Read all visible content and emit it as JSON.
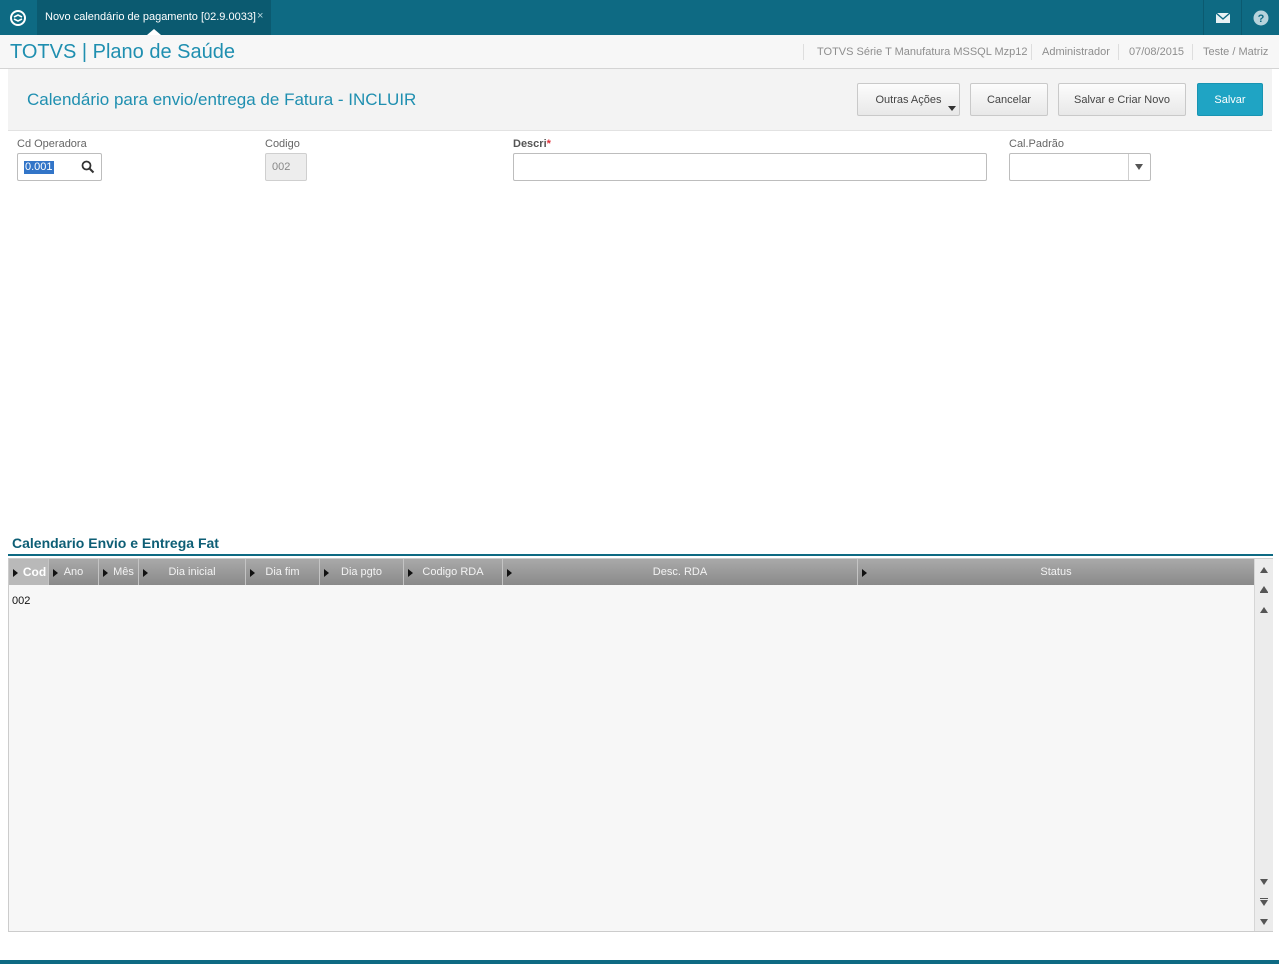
{
  "topbar": {
    "tab_label": "Novo calendário de pagamento [02.9.0033]",
    "tab_close": "×",
    "icons": [
      "totvs-logo-icon",
      "mail-icon",
      "help-icon"
    ]
  },
  "header": {
    "app_title": "TOTVS | Plano de Saúde",
    "system": "TOTVS Série T Manufatura MSSQL Mzp12",
    "user": "Administrador",
    "date": "07/08/2015",
    "branch": "Teste / Matriz"
  },
  "page": {
    "title": "Calendário para envio/entrega de Fatura - INCLUIR",
    "buttons": {
      "more_actions": "Outras Ações",
      "cancel": "Cancelar",
      "save_new": "Salvar e Criar Novo",
      "save": "Salvar"
    }
  },
  "form": {
    "cd_operadora_label": "Cd Operadora",
    "cd_operadora_value": "0.001",
    "codigo_label": "Codigo",
    "codigo_value": "002",
    "descri_label": "Descri",
    "descri_required": "*",
    "descri_value": "",
    "cal_padrao_label": "Cal.Padrão",
    "cal_padrao_value": ""
  },
  "grid": {
    "title": "Calendario Envio e Entrega Fat",
    "columns": [
      "Cod",
      "Ano",
      "Mês",
      "Dia inicial",
      "Dia fim",
      "Dia pgto",
      "Codigo RDA",
      "Desc. RDA",
      "Status"
    ],
    "rows": [
      [
        "002",
        "",
        "",
        "",
        "",
        "",
        "",
        "",
        ""
      ]
    ]
  },
  "colors": {
    "topbar": "#0e6a83",
    "accent": "#1f8fb0",
    "primary_button": "#1fa4c4"
  }
}
